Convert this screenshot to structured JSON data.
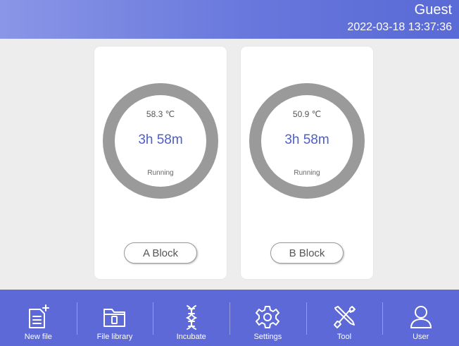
{
  "header": {
    "user": "Guest",
    "datetime": "2022-03-18 13:37:36"
  },
  "blocks": [
    {
      "temperature": "58.3 ℃",
      "remaining": "3h 58m",
      "status": "Running",
      "button_label": "A Block",
      "progress": 1.0
    },
    {
      "temperature": "50.9 ℃",
      "remaining": "3h 58m",
      "status": "Running",
      "button_label": "B Block",
      "progress": 1.0
    }
  ],
  "nav": {
    "items": [
      {
        "label": "New file",
        "icon": "new-file-icon"
      },
      {
        "label": "File library",
        "icon": "folder-icon"
      },
      {
        "label": "Incubate",
        "icon": "dna-icon"
      },
      {
        "label": "Settings",
        "icon": "gear-icon"
      },
      {
        "label": "Tool",
        "icon": "tools-icon"
      },
      {
        "label": "User",
        "icon": "user-icon"
      }
    ]
  },
  "colors": {
    "header_start": "#8a96e6",
    "header_end": "#5a6ad6",
    "nav_bg": "#5c69d6",
    "ring": "#9a9a9a",
    "time_text": "#4d5fc7"
  }
}
